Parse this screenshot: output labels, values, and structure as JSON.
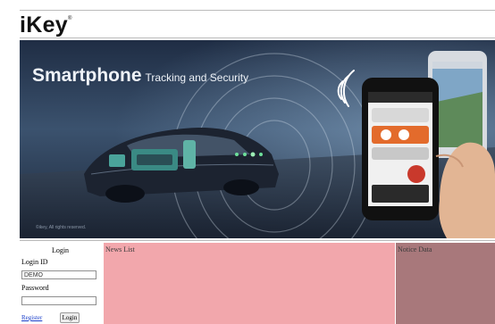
{
  "header": {
    "logo": "iKey",
    "logo_mark": "®"
  },
  "banner": {
    "headline_big": "Smartphone",
    "headline_small": "Tracking and Security",
    "copyright": "©ikey, All rights reserved."
  },
  "login": {
    "title": "Login",
    "id_label": "Login ID",
    "id_value": "DEMO",
    "password_label": "Password",
    "password_value": "",
    "register_link": "Register",
    "login_button": "Login"
  },
  "panels": {
    "news_title": "News List",
    "notice_title": "Notice Data"
  },
  "colors": {
    "news_bg": "#f2a7ac",
    "notice_bg": "#a8787b",
    "banner_bg": "#2b3b55"
  }
}
